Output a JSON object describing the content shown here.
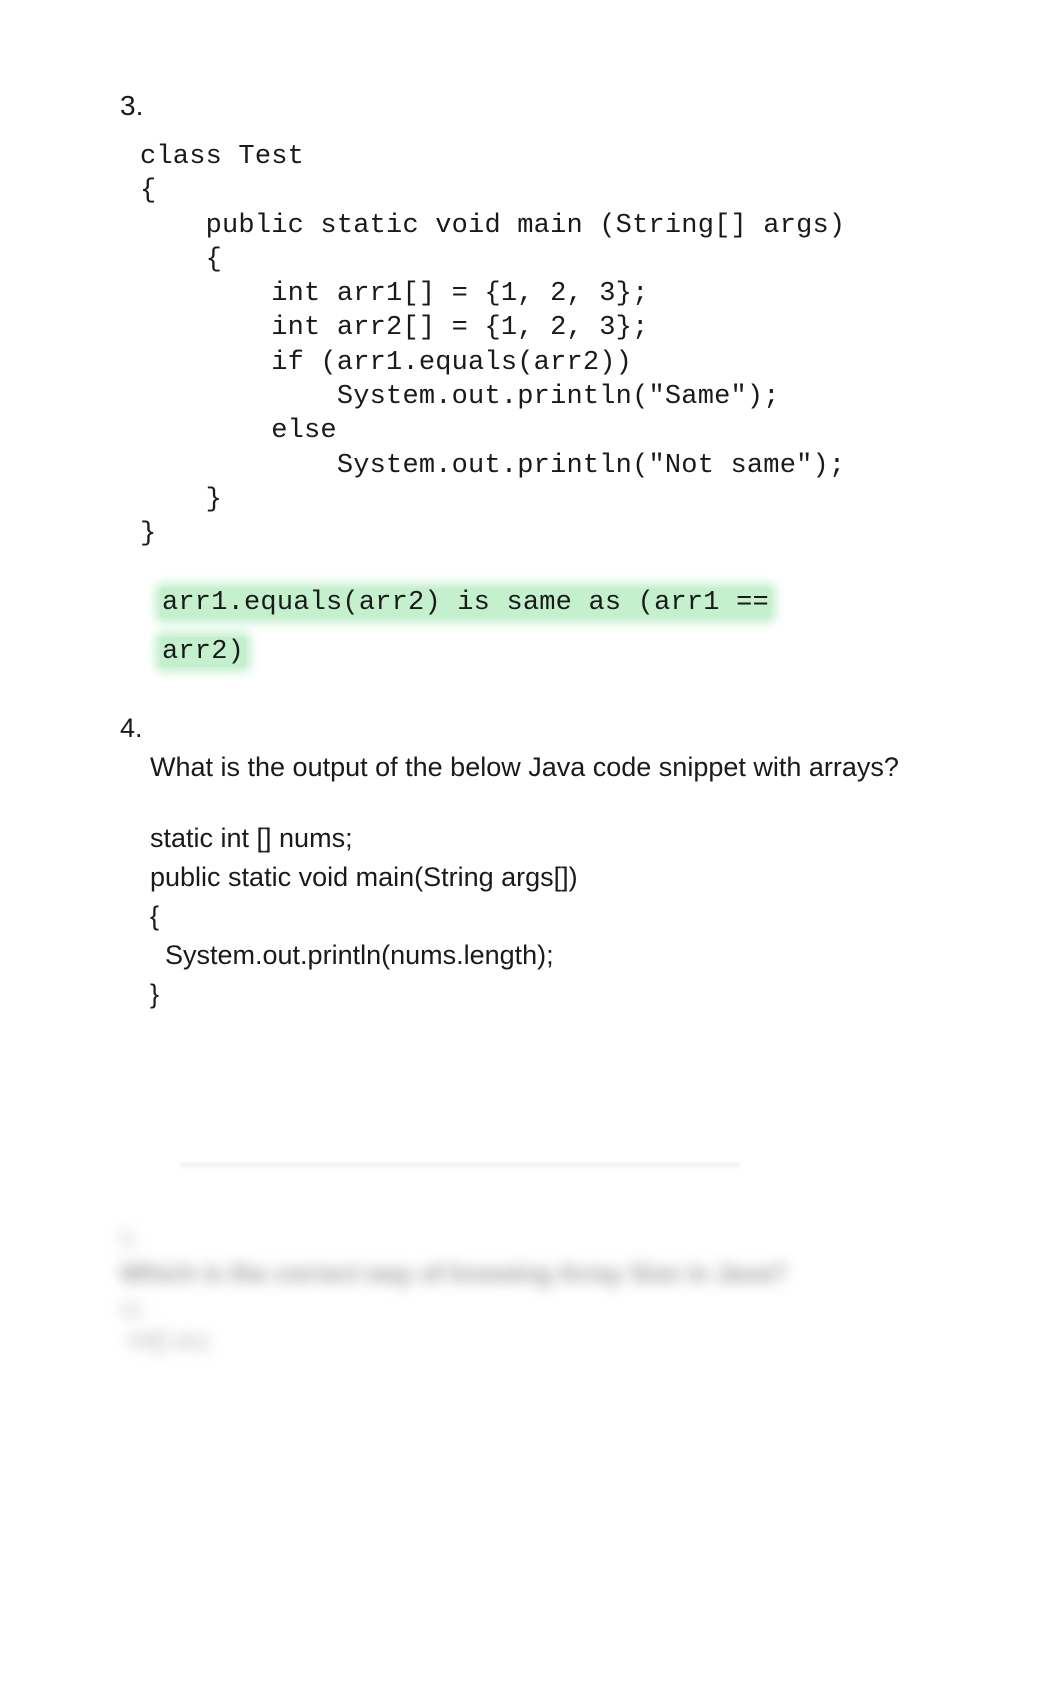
{
  "q3": {
    "number": "3.",
    "code": "class Test\n{\n    public static void main (String[] args)\n    {\n        int arr1[] = {1, 2, 3};\n        int arr2[] = {1, 2, 3};\n        if (arr1.equals(arr2))\n            System.out.println(\"Same\");\n        else\n            System.out.println(\"Not same\");\n    }\n}",
    "answer_line1": "arr1.equals(arr2) is same as (arr1 ==",
    "answer_line2": "arr2)"
  },
  "q4": {
    "number": "4.",
    "question": "What is the output of the below Java code snippet with arrays?",
    "code": "static int [] nums;\npublic static void main(String args[])\n{\n  System.out.println(nums.length);\n}"
  },
  "blurred": {
    "q": "5.",
    "title": "Which is the correct way of knowing Array Size in Java?",
    "sub": "A)",
    "code": "int[] ary;"
  }
}
